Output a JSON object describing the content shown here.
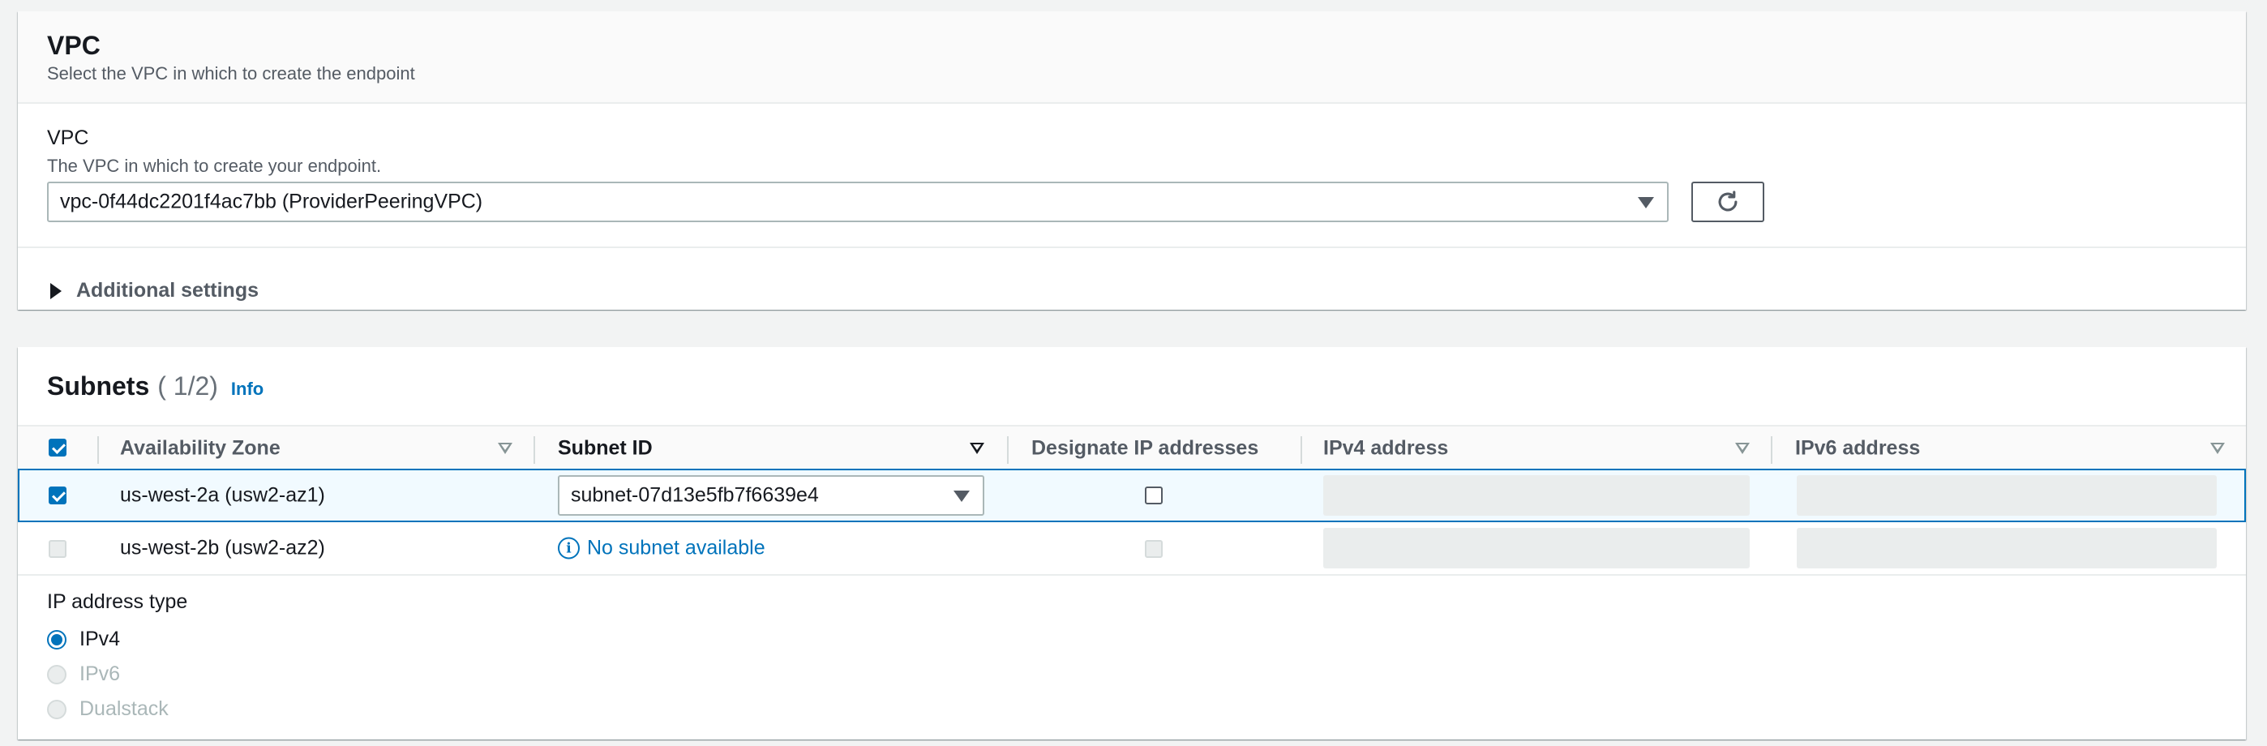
{
  "vpc_section": {
    "title": "VPC",
    "description": "Select the VPC in which to create the endpoint",
    "field_label": "VPC",
    "field_description": "The VPC in which to create your endpoint.",
    "selected_vpc": "vpc-0f44dc2201f4ac7bb (ProviderPeeringVPC)",
    "refresh_icon": "refresh-icon",
    "additional_settings_label": "Additional settings"
  },
  "subnets_section": {
    "title": "Subnets",
    "count": "( 1/2)",
    "info_link": "Info",
    "columns": {
      "availability_zone": "Availability Zone",
      "subnet_id": "Subnet ID",
      "designate_ip": "Designate IP addresses",
      "ipv4": "IPv4 address",
      "ipv6": "IPv6 address"
    },
    "rows": [
      {
        "selected": true,
        "availability_zone": "us-west-2a (usw2-az1)",
        "subnet_id": "subnet-07d13e5fb7f6639e4",
        "designate_ip": false,
        "ipv4": "",
        "ipv6": ""
      },
      {
        "selected": false,
        "availability_zone": "us-west-2b (usw2-az2)",
        "subnet_status": "No subnet available",
        "designate_ip": false,
        "ipv4": "",
        "ipv6": ""
      }
    ]
  },
  "ip_address_type": {
    "label": "IP address type",
    "options": [
      {
        "label": "IPv4",
        "selected": true,
        "enabled": true
      },
      {
        "label": "IPv6",
        "selected": false,
        "enabled": false
      },
      {
        "label": "Dualstack",
        "selected": false,
        "enabled": false
      }
    ]
  },
  "colors": {
    "accent": "#0073bb",
    "background": "#f2f3f3",
    "panel": "#ffffff",
    "text": "#16191f",
    "muted_text": "#545b64"
  }
}
